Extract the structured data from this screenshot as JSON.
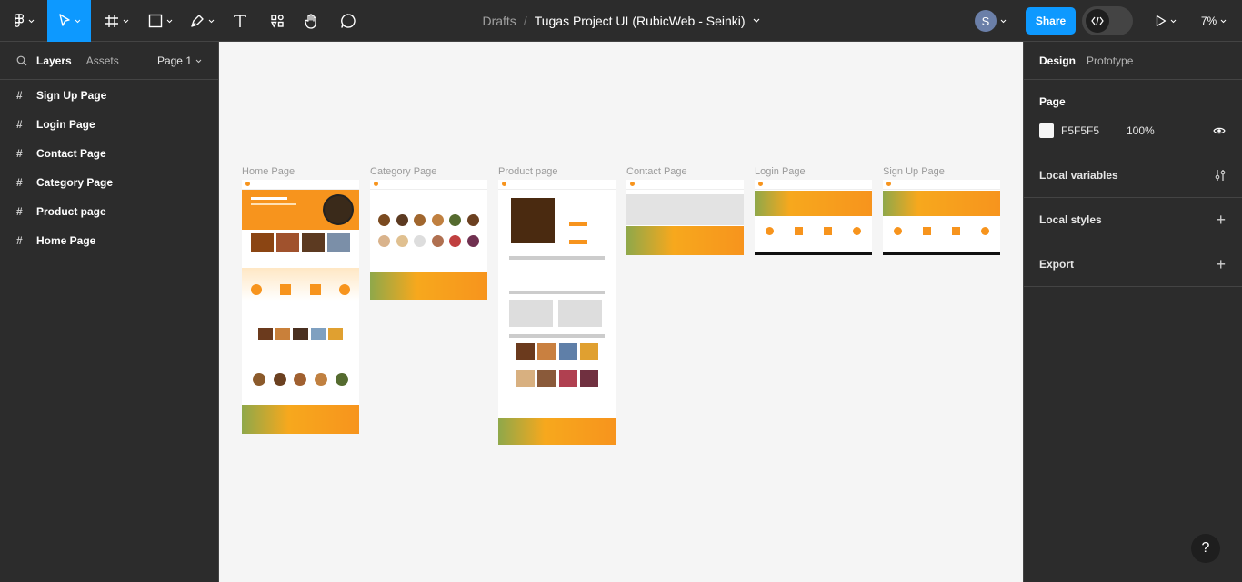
{
  "breadcrumb": {
    "workspace": "Drafts",
    "separator": "/",
    "file_name": "Tugas Project UI (RubicWeb - Seinki)"
  },
  "toolbar": {
    "avatar_initial": "S",
    "share_label": "Share",
    "zoom": "7%"
  },
  "left_panel": {
    "tabs": [
      "Layers",
      "Assets"
    ],
    "page_selector": "Page 1",
    "layers": [
      "Sign Up Page",
      "Login Page",
      "Contact Page",
      "Category Page",
      "Product page",
      "Home Page"
    ]
  },
  "canvas": {
    "background": "#F5F5F5",
    "frames": [
      "Home Page",
      "Category Page",
      "Product page",
      "Contact Page",
      "Login Page",
      "Sign Up Page"
    ]
  },
  "right_panel": {
    "tabs": [
      "Design",
      "Prototype"
    ],
    "page_section": {
      "title": "Page",
      "color_hex": "F5F5F5",
      "opacity": "100%"
    },
    "sections": [
      "Local variables",
      "Local styles",
      "Export"
    ]
  },
  "help_label": "?",
  "colors": {
    "accent_blue": "#0d99ff",
    "brand_orange": "#f7941d",
    "dark_bg": "#2c2c2c"
  }
}
